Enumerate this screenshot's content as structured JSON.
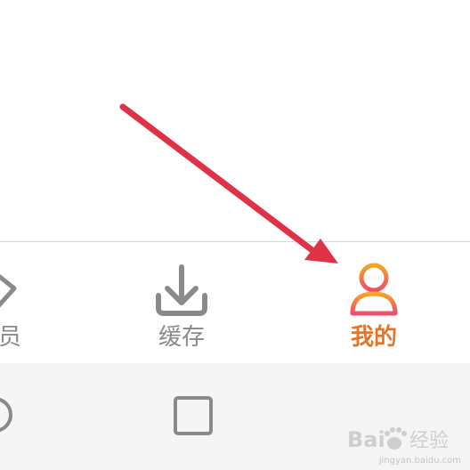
{
  "bottom_nav": {
    "tabs": [
      {
        "label": "员",
        "icon": "vip-diamond-icon",
        "active": false
      },
      {
        "label": "缓存",
        "icon": "download-icon",
        "active": false
      },
      {
        "label": "我的",
        "icon": "profile-icon",
        "active": true
      }
    ]
  },
  "system_nav": {
    "buttons": [
      {
        "icon": "home-circle-icon"
      },
      {
        "icon": "recents-square-icon"
      }
    ]
  },
  "watermark": {
    "text": "Bai 经验",
    "url": "jingyan.baidu.com"
  },
  "colors": {
    "active_tab": "#e3752a",
    "inactive_tab": "#8a8a8a",
    "arrow": "#e03246"
  }
}
